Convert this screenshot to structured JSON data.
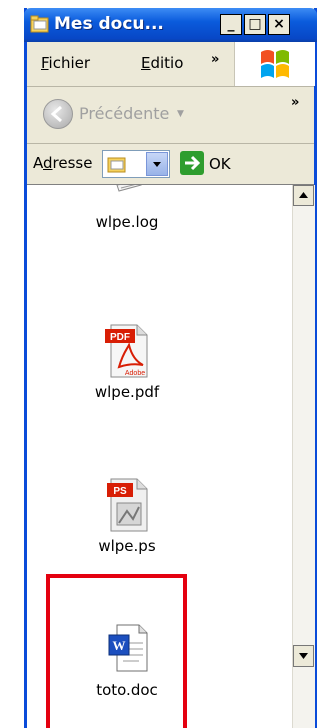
{
  "window": {
    "title": "Mes docu...",
    "controls": {
      "minimize": "_",
      "maximize": "□",
      "close": "×"
    }
  },
  "menubar": {
    "items": [
      {
        "label_u": "F",
        "label_rest": "ichier"
      },
      {
        "label_u": "E",
        "label_rest": "ditio"
      }
    ],
    "overflow": "»"
  },
  "toolbar": {
    "back_label": "Précédente",
    "overflow": "»"
  },
  "address": {
    "label_pre": "A",
    "label_u": "d",
    "label_post": "resse",
    "go_label": "OK"
  },
  "files": [
    {
      "name": "wlpe.log",
      "icon": "text-log-icon"
    },
    {
      "name": "wlpe.pdf",
      "icon": "pdf-icon",
      "badge": "PDF",
      "brand": "Adobe"
    },
    {
      "name": "wlpe.ps",
      "icon": "postscript-icon",
      "badge": "PS"
    },
    {
      "name": "toto.doc",
      "icon": "word-doc-icon",
      "badge": "W"
    }
  ],
  "colors": {
    "titlebar": "#0a5bdc",
    "highlight": "#e4000f",
    "window_face": "#ece9d8"
  }
}
